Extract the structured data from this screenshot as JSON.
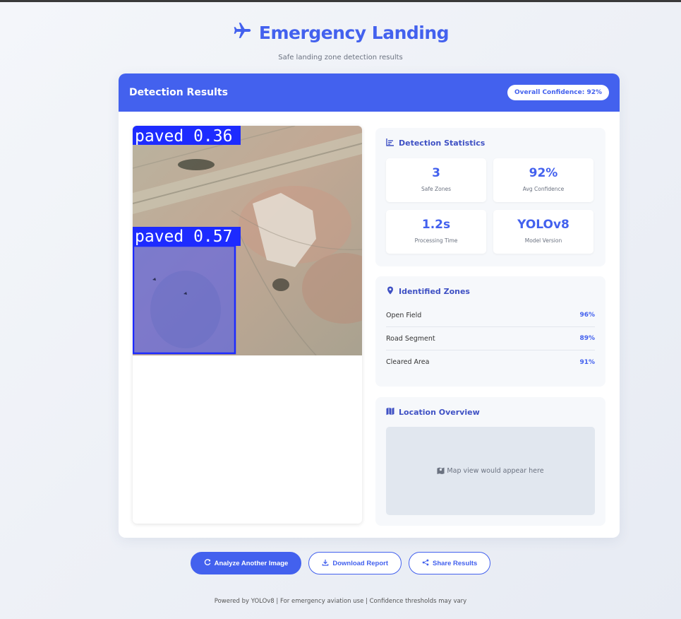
{
  "header": {
    "title": "Emergency Landing",
    "subtitle": "Safe landing zone detection results",
    "icon": "plane-icon"
  },
  "results": {
    "title": "Detection Results",
    "overall_confidence": "Overall Confidence: 92%"
  },
  "image": {
    "detections": [
      {
        "label": "paved 0.36"
      },
      {
        "label": "paved 0.57"
      }
    ]
  },
  "stats": {
    "title": "Detection Statistics",
    "items": [
      {
        "value": "3",
        "label": "Safe Zones"
      },
      {
        "value": "92%",
        "label": "Avg Confidence"
      },
      {
        "value": "1.2s",
        "label": "Processing Time"
      },
      {
        "value": "YOLOv8",
        "label": "Model Version"
      }
    ]
  },
  "zones": {
    "title": "Identified Zones",
    "items": [
      {
        "name": "Open Field",
        "pct": "96%"
      },
      {
        "name": "Road Segment",
        "pct": "89%"
      },
      {
        "name": "Cleared Area",
        "pct": "91%"
      }
    ]
  },
  "location": {
    "title": "Location Overview",
    "placeholder": "Map view would appear here"
  },
  "actions": {
    "analyze": "Analyze Another Image",
    "download": "Download Report",
    "share": "Share Results"
  },
  "footer": "Powered by YOLOv8 | For emergency aviation use | Confidence thresholds may vary",
  "colors": {
    "accent": "#4361ee",
    "detection_box": "#1d2bff"
  }
}
